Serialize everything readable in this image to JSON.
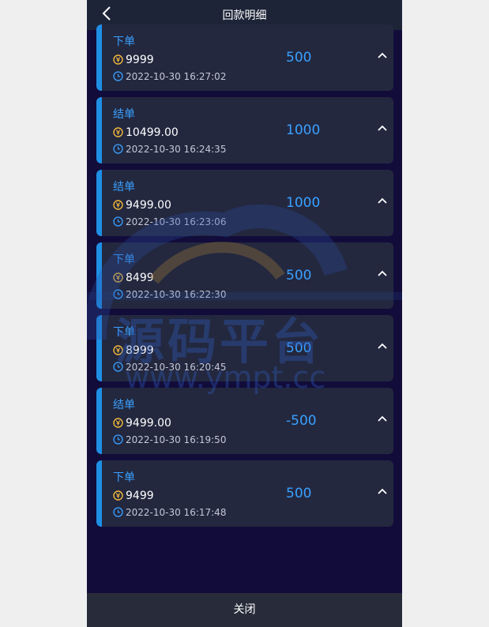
{
  "header": {
    "title": "回款明细",
    "back_icon": "chevron-left-icon"
  },
  "records": [
    {
      "type": "下单",
      "amount": "9999",
      "time": "2022-10-30 16:27:02",
      "value": "500"
    },
    {
      "type": "结单",
      "amount": "10499.00",
      "time": "2022-10-30 16:24:35",
      "value": "1000"
    },
    {
      "type": "结单",
      "amount": "9499.00",
      "time": "2022-10-30 16:23:06",
      "value": "1000"
    },
    {
      "type": "下单",
      "amount": "8499",
      "time": "2022-10-30 16:22:30",
      "value": "500"
    },
    {
      "type": "下单",
      "amount": "8999",
      "time": "2022-10-30 16:20:45",
      "value": "500"
    },
    {
      "type": "结单",
      "amount": "9499.00",
      "time": "2022-10-30 16:19:50",
      "value": "-500"
    },
    {
      "type": "下单",
      "amount": "9499",
      "time": "2022-10-30 16:17:48",
      "value": "500"
    }
  ],
  "footer": {
    "close_label": "关闭"
  },
  "watermark": {
    "text_cn": "源码平台",
    "url": "www.ympt.cc"
  },
  "colors": {
    "accent": "#3aa0ff",
    "coin": "#f2b73a",
    "card": "#23283f",
    "background": "#120c3a"
  }
}
